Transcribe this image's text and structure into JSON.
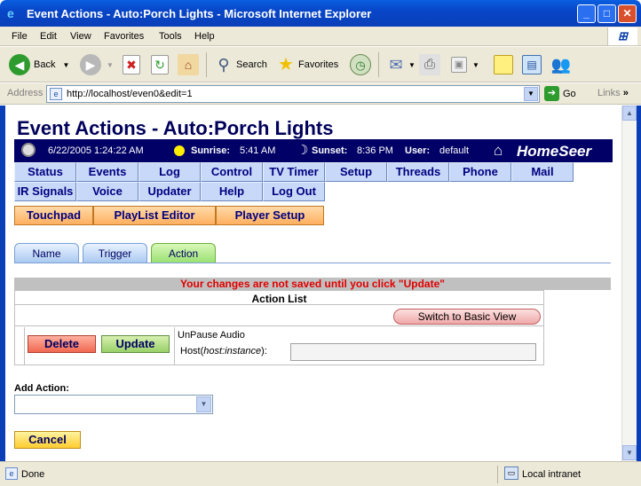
{
  "window": {
    "title": "Event Actions - Auto:Porch Lights - Microsoft Internet Explorer",
    "min_label": "_",
    "max_label": "□",
    "close_label": "✕"
  },
  "menu": [
    "File",
    "Edit",
    "View",
    "Favorites",
    "Tools",
    "Help"
  ],
  "toolbar": {
    "back": "Back",
    "search": "Search",
    "favorites": "Favorites"
  },
  "address": {
    "label": "Address",
    "url": "http://localhost/even0&edit=1",
    "go": "Go",
    "links": "Links"
  },
  "page": {
    "title": "Event Actions - Auto:Porch Lights",
    "info": {
      "datetime": "6/22/2005 1:24:22 AM",
      "sunrise_label": "Sunrise:",
      "sunrise": "5:41 AM",
      "sunset_label": "Sunset:",
      "sunset": "8:36 PM",
      "user_label": "User:",
      "user": "default",
      "brand": "HomeSeer"
    },
    "nav_row1": [
      "Status",
      "Events",
      "Log",
      "Control",
      "TV Timer",
      "Setup",
      "Threads",
      "Phone",
      "Mail"
    ],
    "nav_row2": [
      "IR Signals",
      "Voice",
      "Updater",
      "Help",
      "Log Out"
    ],
    "nav_row3": [
      "Touchpad",
      "PlayList Editor",
      "Player Setup"
    ],
    "tabs": [
      "Name",
      "Trigger",
      "Action"
    ],
    "active_tab": "Action",
    "warning": "Your changes are not saved until you click \"Update\"",
    "action_list": {
      "header": "Action List",
      "switch_btn": "Switch to Basic View",
      "delete_btn": "Delete",
      "update_btn": "Update",
      "action_name": "UnPause Audio",
      "host_label_pre": "Host(",
      "host_label_em": "host:instance",
      "host_label_post": "):",
      "host_value": ""
    },
    "add_action_label": "Add Action:",
    "add_action_value": "",
    "cancel_btn": "Cancel"
  },
  "status": {
    "text": "Done",
    "zone": "Local intranet"
  },
  "colors": {
    "title_blue": "#00005a",
    "info_bar": "#000066",
    "warning_red": "#e00000"
  }
}
